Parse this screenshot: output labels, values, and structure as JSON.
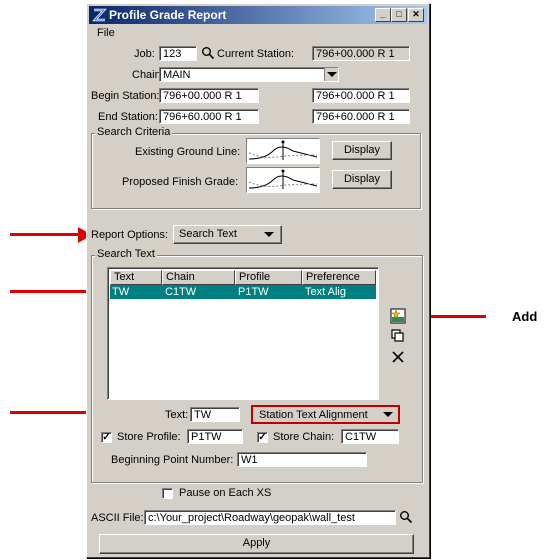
{
  "window": {
    "title": "Profile Grade Report"
  },
  "menu": {
    "file": "File"
  },
  "job": {
    "label": "Job:",
    "value": "123"
  },
  "current_station": {
    "label": "Current Station:",
    "value": "796+00.000 R 1"
  },
  "chain": {
    "label": "Chain:",
    "value": "MAIN"
  },
  "begin_station": {
    "label": "Begin Station:",
    "value1": "796+00.000 R 1",
    "value2": "796+00.000 R 1"
  },
  "end_station": {
    "label": "End Station:",
    "value1": "796+60.000 R 1",
    "value2": "796+60.000 R 1"
  },
  "search_criteria": {
    "title": "Search Criteria",
    "existing_label": "Existing Ground Line:",
    "proposed_label": "Proposed Finish Grade:",
    "display_label": "Display"
  },
  "report_options": {
    "label": "Report Options:",
    "value": "Search Text"
  },
  "search_text": {
    "title": "Search Text",
    "columns": [
      "Text",
      "Chain",
      "Profile",
      "Preference"
    ],
    "rows": [
      {
        "text": "TW",
        "chain": "C1TW",
        "profile": "P1TW",
        "preference": "Text Alig"
      }
    ],
    "text_label": "Text:",
    "text_value": "TW",
    "alignment_value": "Station Text Alignment",
    "store_profile_label": "Store Profile:",
    "store_profile_value": "P1TW",
    "store_chain_label": "Store Chain:",
    "store_chain_value": "C1TW",
    "beginning_point_label": "Beginning Point Number:",
    "beginning_point_value": "W1"
  },
  "pause_label": "Pause on Each XS",
  "ascii": {
    "label": "ASCII File:",
    "value": "c:\\Your_project\\Roadway\\geopak\\wall_test"
  },
  "apply_label": "Apply",
  "annotation": {
    "add_label": "Add"
  },
  "colors": {
    "arrow": "#e00000",
    "selection": "#008080",
    "titlebar": "#0a246a"
  }
}
